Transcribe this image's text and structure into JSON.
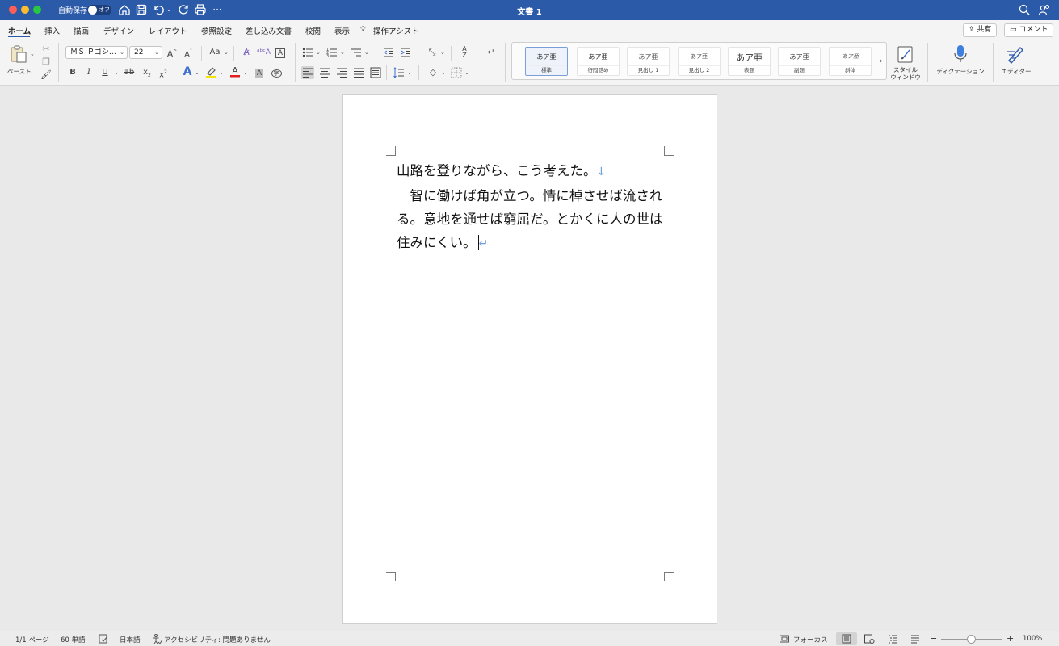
{
  "titlebar": {
    "autosave_label": "自動保存",
    "autosave_state": "オフ",
    "doc_title": "文書 1",
    "icons": [
      "home-icon",
      "save-icon",
      "undo-icon",
      "redo-icon",
      "print-icon",
      "more-icon",
      "search-icon",
      "account-icon"
    ]
  },
  "tabs": [
    "ホーム",
    "挿入",
    "描画",
    "デザイン",
    "レイアウト",
    "参照設定",
    "差し込み文書",
    "校閲",
    "表示",
    "操作アシスト"
  ],
  "active_tab": "ホーム",
  "share_label": "共有",
  "comment_label": "コメント",
  "ribbon": {
    "paste_label": "ペースト",
    "font_name": "ＭＳ Ｐゴシ…",
    "font_size": "22",
    "font_case": "Aa",
    "styles": [
      "標準",
      "行間詰め",
      "見出し 1",
      "見出し 2",
      "表題",
      "副題",
      "斜体"
    ],
    "style_preview": "あア亜",
    "style_window_label_1": "スタイル",
    "style_window_label_2": "ウィンドウ",
    "dictation_label": "ディクテーション",
    "editor_label": "エディター"
  },
  "document": {
    "line1": "山路を登りながら、こう考えた。",
    "line1_mark": "↓",
    "para2": "　智に働けば角が立つ。情に棹させば流される。意地を通せば窮屈だ。とかくに人の世は住みにくい。",
    "para2_mark": "↵"
  },
  "statusbar": {
    "page": "1/1 ページ",
    "words": "60 単語",
    "language": "日本語",
    "accessibility": "アクセシビリティ: 問題ありません",
    "focus": "フォーカス",
    "zoom": "100%",
    "zoom_minus": "−",
    "zoom_plus": "+",
    "zoom_level_percent": 100
  },
  "colors": {
    "titlebar": "#2b5aa9",
    "accent": "#2b5aa9",
    "paragraph_mark": "#6f9fe0",
    "highlight_yellow": "#f5e400",
    "font_color_red": "#e02020"
  }
}
